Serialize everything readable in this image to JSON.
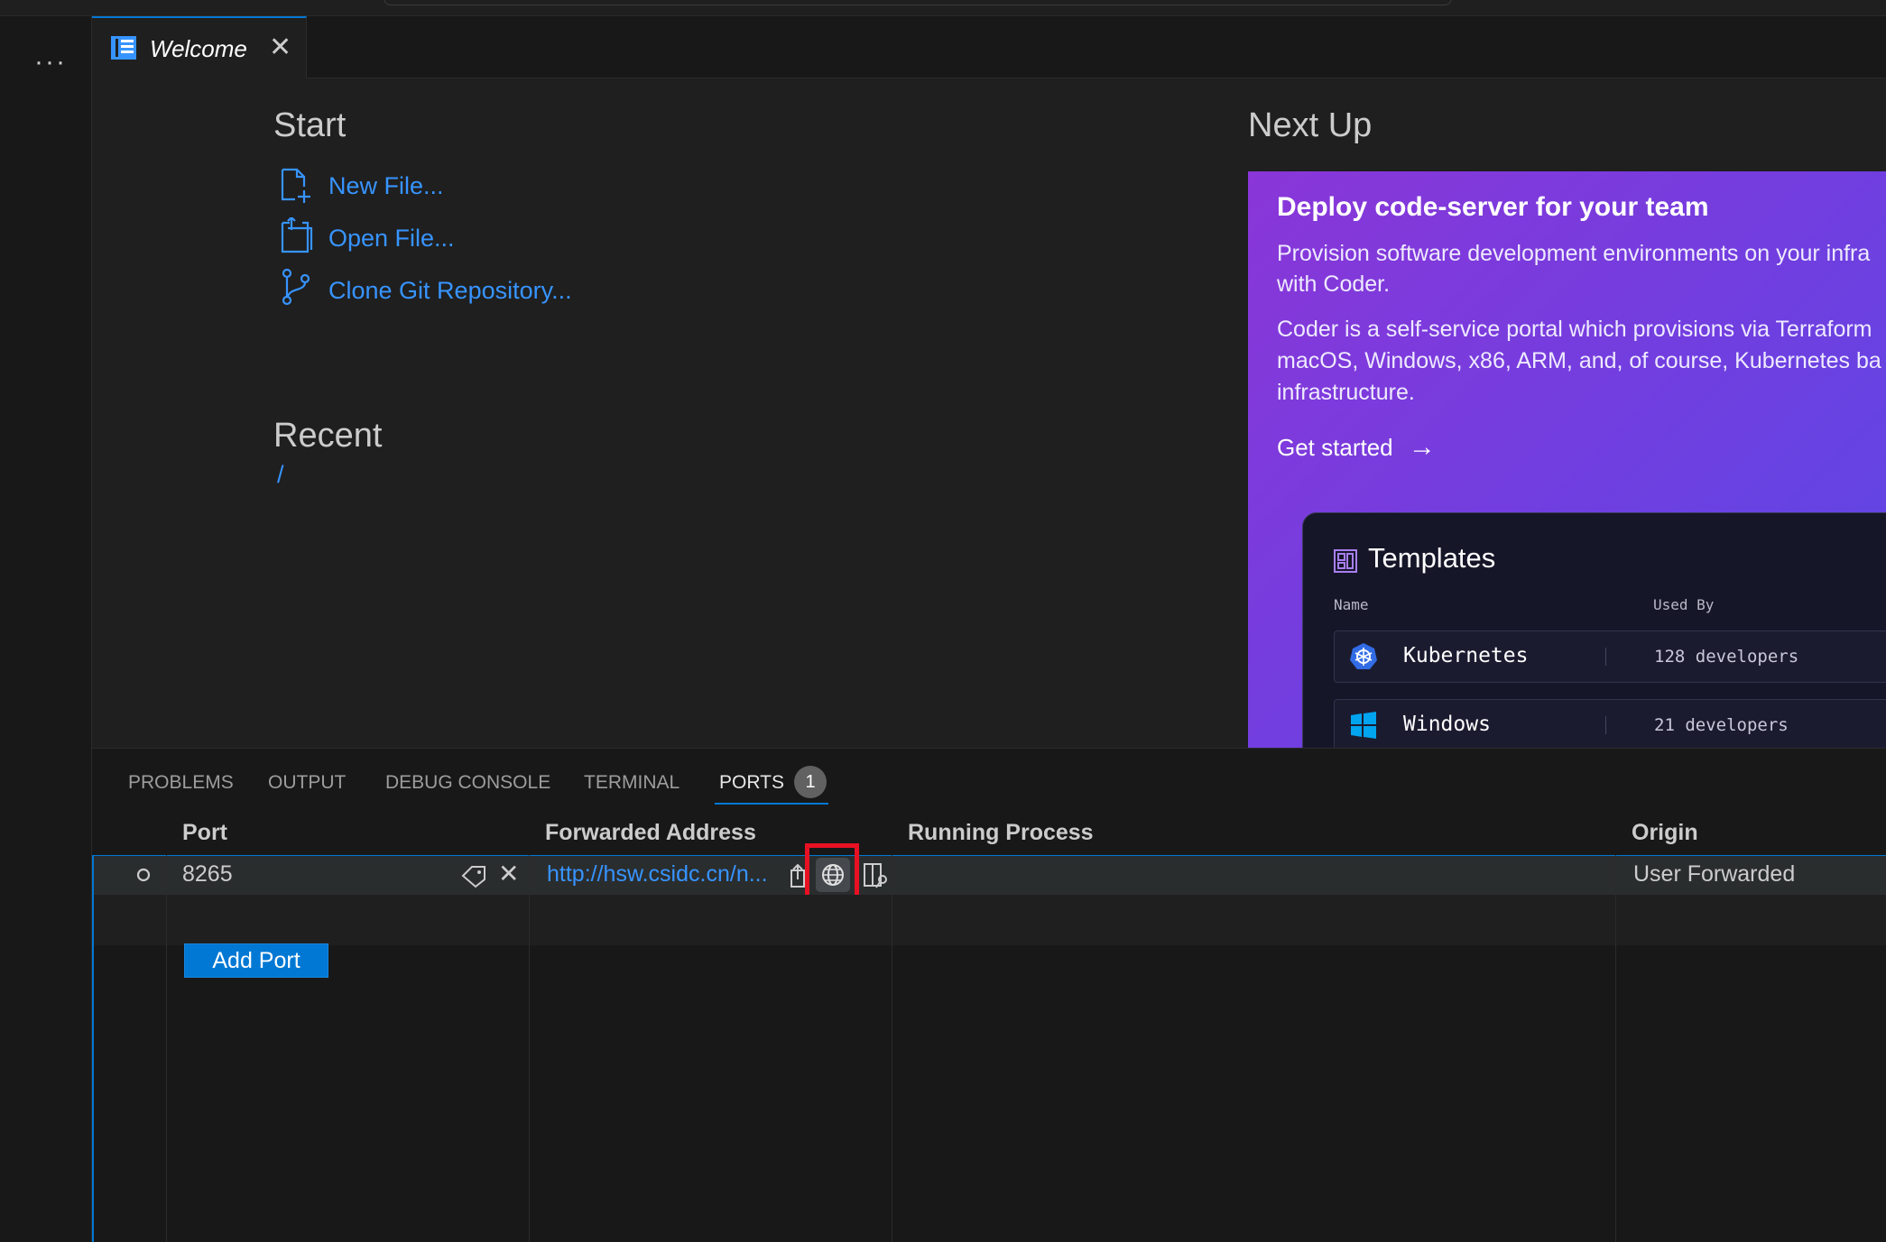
{
  "tab": {
    "label": "Welcome",
    "close": "✕"
  },
  "activity": {
    "more": "···"
  },
  "welcome": {
    "start_heading": "Start",
    "start_items": [
      {
        "label": "New File...",
        "icon": "new-file-icon"
      },
      {
        "label": "Open File...",
        "icon": "open-file-icon"
      },
      {
        "label": "Clone Git Repository...",
        "icon": "git-branch-icon"
      }
    ],
    "recent_heading": "Recent",
    "recent_items": [
      "/"
    ],
    "next_up_heading": "Next Up"
  },
  "card": {
    "title": "Deploy code-server for your team",
    "p1_line1": "Provision software development environments on your infra",
    "p1_line2": "with Coder.",
    "p2_line1": "Coder is a self-service portal which provisions via Terraform",
    "p2_line2": "macOS, Windows, x86, ARM, and, of course, Kubernetes ba",
    "p2_line3": "infrastructure.",
    "cta": "Get started",
    "cta_arrow": "→",
    "templates": {
      "title": "Templates",
      "col_name": "Name",
      "col_used": "Used By",
      "rows": [
        {
          "name": "Kubernetes",
          "used": "128 developers",
          "icon": "kubernetes-icon"
        },
        {
          "name": "Windows",
          "used": "21 developers",
          "icon": "windows-icon"
        }
      ]
    }
  },
  "panel": {
    "tabs": [
      "PROBLEMS",
      "OUTPUT",
      "DEBUG CONSOLE",
      "TERMINAL",
      "PORTS"
    ],
    "ports_badge": "1",
    "columns": {
      "port": "Port",
      "address": "Forwarded Address",
      "process": "Running Process",
      "origin": "Origin"
    },
    "row": {
      "port": "8265",
      "address": "http://hsw.csidc.cn/n...",
      "process": "",
      "origin": "User Forwarded"
    },
    "add_port": "Add Port"
  },
  "colors": {
    "accent": "#0078d4",
    "link": "#3794ff",
    "highlight": "#e81123"
  }
}
